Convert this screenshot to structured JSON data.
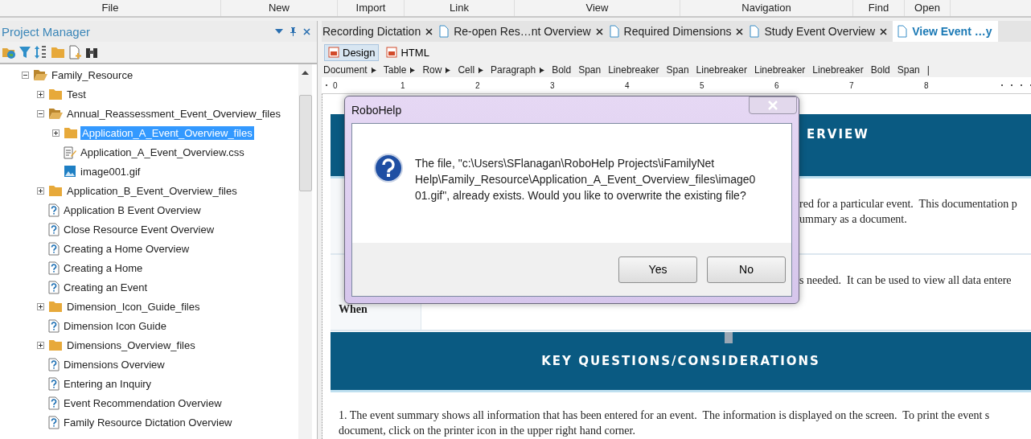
{
  "menu": [
    "File",
    "New",
    "Import",
    "Link",
    "View",
    "Navigation",
    "Find",
    "Open"
  ],
  "project_manager": {
    "title": "Project Manager",
    "tree": [
      {
        "label": "Family_Resource",
        "kind": "folder",
        "expanded": true,
        "selected": false,
        "children": [
          {
            "label": "Test",
            "kind": "folder",
            "expanded": false,
            "selected": false
          },
          {
            "label": "Annual_Reassessment_Event_Overview_files",
            "kind": "folder",
            "expanded": true,
            "selected": false,
            "children": [
              {
                "label": "Application_A_Event_Overview_files",
                "kind": "folder",
                "expanded": false,
                "selected": true
              },
              {
                "label": "Application_A_Event_Overview.css",
                "kind": "css",
                "selected": false
              },
              {
                "label": "image001.gif",
                "kind": "image",
                "selected": false
              }
            ]
          },
          {
            "label": "Application_B_Event_Overview_files",
            "kind": "folder",
            "expanded": false,
            "selected": false
          },
          {
            "label": "Application B Event Overview",
            "kind": "topic",
            "selected": false
          },
          {
            "label": "Close Resource Event Overview",
            "kind": "topic",
            "selected": false
          },
          {
            "label": "Creating a Home Overview",
            "kind": "topic",
            "selected": false
          },
          {
            "label": "Creating a Home",
            "kind": "topic",
            "selected": false
          },
          {
            "label": "Creating an Event",
            "kind": "topic",
            "selected": false
          },
          {
            "label": "Dimension_Icon_Guide_files",
            "kind": "folder",
            "expanded": false,
            "selected": false
          },
          {
            "label": "Dimension Icon Guide",
            "kind": "topic",
            "selected": false
          },
          {
            "label": "Dimensions_Overview_files",
            "kind": "folder",
            "expanded": false,
            "selected": false
          },
          {
            "label": "Dimensions Overview",
            "kind": "topic",
            "selected": false
          },
          {
            "label": "Entering an Inquiry",
            "kind": "topic",
            "selected": false
          },
          {
            "label": "Event Recommendation Overview",
            "kind": "topic",
            "selected": false
          },
          {
            "label": "Family Resource Dictation Overview",
            "kind": "topic",
            "selected": false
          }
        ]
      }
    ]
  },
  "tabs": [
    {
      "label": "Recording Dictation",
      "selected": false,
      "icon": false
    },
    {
      "label": "Re-open Res…nt Overview",
      "selected": false,
      "icon": true
    },
    {
      "label": "Required Dimensions",
      "selected": false,
      "icon": true
    },
    {
      "label": "Study Event Overview",
      "selected": false,
      "icon": true
    },
    {
      "label": "View Event …y",
      "selected": true,
      "icon": true
    }
  ],
  "view_modes": [
    {
      "label": "Design",
      "selected": true
    },
    {
      "label": "HTML",
      "selected": false
    }
  ],
  "breadcrumb": [
    {
      "label": "Document",
      "arrow": true
    },
    {
      "label": "Table",
      "arrow": true
    },
    {
      "label": "Row",
      "arrow": true
    },
    {
      "label": "Cell",
      "arrow": true
    },
    {
      "label": "Paragraph",
      "arrow": true
    },
    {
      "label": "Bold",
      "arrow": false
    },
    {
      "label": "Span",
      "arrow": false
    },
    {
      "label": "Linebreaker",
      "arrow": false
    },
    {
      "label": "Span",
      "arrow": false
    },
    {
      "label": "Linebreaker",
      "arrow": false
    },
    {
      "label": "Linebreaker",
      "arrow": false
    },
    {
      "label": "Linebreaker",
      "arrow": false
    },
    {
      "label": "Bold",
      "arrow": false
    },
    {
      "label": "Span",
      "arrow": false
    },
    {
      "label": "|",
      "arrow": false
    }
  ],
  "ruler": [
    "0",
    "1",
    "2",
    "3",
    "4",
    "5",
    "6",
    "7",
    "8"
  ],
  "document": {
    "heading": "ERVIEW",
    "rows": [
      {
        "lines": [
          "red for a particular event.  This documentation p",
          "ummary as a document."
        ]
      },
      {
        "labels": [
          "When"
        ],
        "lines": [
          "s needed.  It can be used to view all data entere"
        ]
      }
    ],
    "section_heading": "KEY QUESTIONS/CONSIDERATIONS",
    "paragraph_lines": [
      "1. The event summary shows all information that has been entered for an event.  The information is displayed on the screen.  To print the event s",
      "document, click on the printer icon in the upper right hand corner."
    ]
  },
  "dialog": {
    "title": "RoboHelp",
    "message": "The file, \"c:\\Users\\SFlanagan\\RoboHelp Projects\\iFamilyNet Help\\Family_Resource\\Application_A_Event_Overview_files\\image001.gif\", already exists. Would you like to overwrite the existing file?",
    "buttons": [
      "Yes",
      "No"
    ]
  }
}
